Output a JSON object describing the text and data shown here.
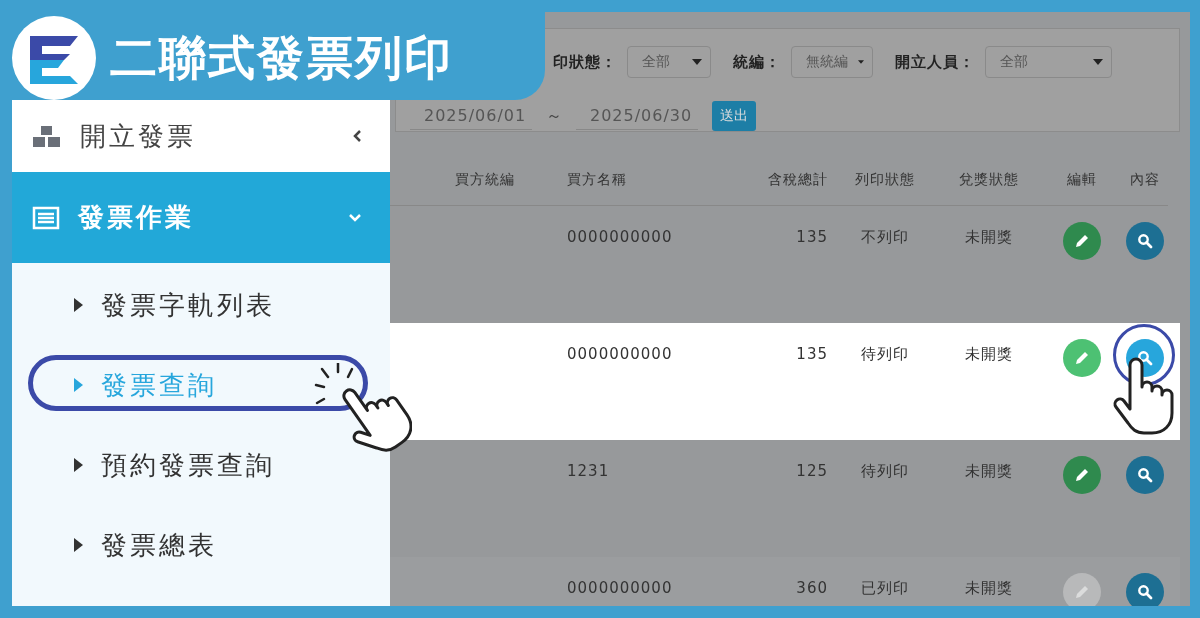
{
  "title": "二聯式發票列印",
  "sidebar": {
    "items": [
      {
        "label": "開立發票",
        "selected": false,
        "expanded": false
      },
      {
        "label": "發票作業",
        "selected": true,
        "expanded": true,
        "children": [
          {
            "label": "發票字軌列表",
            "selected": false
          },
          {
            "label": "發票查詢",
            "selected": true
          },
          {
            "label": "預約發票查詢",
            "selected": false
          },
          {
            "label": "發票總表",
            "selected": false
          }
        ]
      }
    ]
  },
  "filters": {
    "selects": [
      {
        "label": "印狀態：",
        "value": "全部"
      },
      {
        "label": "統編：",
        "value": "無統編"
      },
      {
        "label": "開立人員：",
        "value": "全部"
      }
    ],
    "date_from": "2025/06/01",
    "separator": "～",
    "date_to": "2025/06/30",
    "submit": "送出"
  },
  "table": {
    "columns": [
      "買方統編",
      "買方名稱",
      "含稅總計",
      "列印狀態",
      "兌獎狀態",
      "編輯",
      "內容"
    ],
    "rows": [
      {
        "buyer_name": "0000000000",
        "total": "135",
        "print_status": "不列印",
        "prize_status": "未開獎",
        "edit_disabled": false,
        "highlighted": false
      },
      {
        "buyer_name": "0000000000",
        "total": "135",
        "print_status": "待列印",
        "prize_status": "未開獎",
        "edit_disabled": false,
        "highlighted": true
      },
      {
        "buyer_name": "1231",
        "total": "125",
        "print_status": "待列印",
        "prize_status": "未開獎",
        "edit_disabled": false,
        "highlighted": false
      },
      {
        "buyer_name": "0000000000",
        "total": "360",
        "print_status": "已列印",
        "prize_status": "未開獎",
        "edit_disabled": true,
        "highlighted": false
      }
    ]
  }
}
